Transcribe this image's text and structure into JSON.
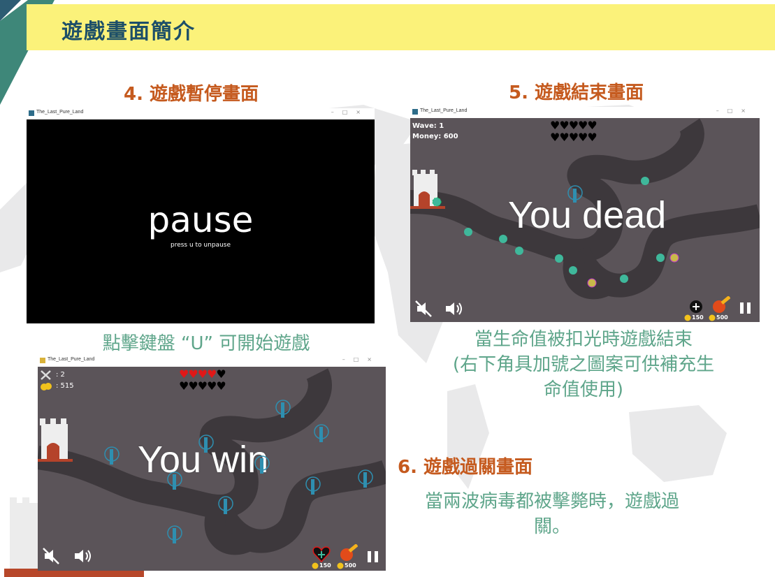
{
  "slide": {
    "title": "遊戲畫面簡介",
    "accent_colors": {
      "title_bar": "#fbf27a",
      "title_text": "#1d4f68",
      "section": "#c55a1e",
      "caption": "#5ea58a"
    }
  },
  "sections": {
    "pause": {
      "heading": "4. 遊戲暫停畫面",
      "caption": "點擊鍵盤 “U” 可開始遊戲",
      "window_title": "The_Last_Pure_Land",
      "big_text": "pause",
      "hint": "press u to unpause"
    },
    "gameover": {
      "heading": "5. 遊戲結束畫面",
      "caption_lines": [
        "當生命值被扣光時遊戲結束",
        "(右下角具加號之圖案可供補充生",
        "命值使用)"
      ],
      "window_title": "The_Last_Pure_Land",
      "wave_label": "Wave: 1",
      "money_label": "Money: 600",
      "big_text": "You dead",
      "shop": {
        "heal_price": "150",
        "fire_price": "500"
      }
    },
    "win": {
      "heading": "6. 遊戲過關畫面",
      "caption_lines": [
        "當兩波病毒都被擊斃時，遊戲過",
        "關。"
      ],
      "window_title": "The_Last_Pure_Land",
      "wave_count": ": 2",
      "money_count": ": 515",
      "big_text": "You win",
      "shop": {
        "heal_price": "150",
        "fire_price": "500"
      }
    }
  },
  "icons": [
    "world-map-icon",
    "castle-icon",
    "mute-icon",
    "volume-icon",
    "pause-icon",
    "heart-icon",
    "heal-potion-icon",
    "fireball-icon",
    "virus-icon",
    "tower-icon",
    "coin-icon",
    "swords-icon"
  ]
}
